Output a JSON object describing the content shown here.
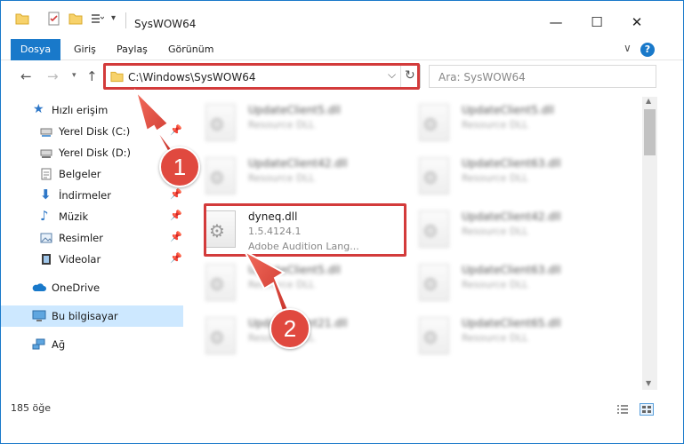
{
  "window": {
    "title": "SysWOW64",
    "minimize_glyph": "—",
    "maximize_glyph": "☐",
    "close_glyph": "✕"
  },
  "ribbon": {
    "tabs": [
      "Dosya",
      "Giriş",
      "Paylaş",
      "Görünüm"
    ],
    "expand_glyph": "∨",
    "help_glyph": "?"
  },
  "address": {
    "path": "C:\\Windows\\SysWOW64",
    "search_placeholder": "Ara: SysWOW64"
  },
  "nav": {
    "items": [
      {
        "label": "Hızlı erişim",
        "icon": "star-icon",
        "pinned": false
      },
      {
        "label": "Yerel Disk (C:)",
        "icon": "drive-icon",
        "pinned": true
      },
      {
        "label": "Yerel Disk (D:)",
        "icon": "drive-icon",
        "pinned": false
      },
      {
        "label": "Belgeler",
        "icon": "documents-icon",
        "pinned": true
      },
      {
        "label": "İndirmeler",
        "icon": "download-icon",
        "pinned": true
      },
      {
        "label": "Müzik",
        "icon": "music-icon",
        "pinned": true
      },
      {
        "label": "Resimler",
        "icon": "pictures-icon",
        "pinned": true
      },
      {
        "label": "Videolar",
        "icon": "video-icon",
        "pinned": true
      },
      {
        "label": "OneDrive",
        "icon": "cloud-icon",
        "pinned": false
      },
      {
        "label": "Bu bilgisayar",
        "icon": "computer-icon",
        "pinned": false
      },
      {
        "label": "Ağ",
        "icon": "network-icon",
        "pinned": false
      }
    ]
  },
  "files": {
    "left": [
      {
        "name": "UpdateClient5.dll",
        "sub1": "Resource DLL",
        "sub2": ""
      },
      {
        "name": "UpdateClient42.dll",
        "sub1": "Resource DLL",
        "sub2": ""
      },
      {
        "name": "dyneq.dll",
        "sub1": "1.5.4124.1",
        "sub2": "Adobe Audition Lang..."
      },
      {
        "name": "UpdateClient5.dll",
        "sub1": "Resource DLL",
        "sub2": ""
      },
      {
        "name": "UpdateClient21.dll",
        "sub1": "Resource DLL",
        "sub2": ""
      }
    ],
    "right": [
      {
        "name": "UpdateClient5.dll",
        "sub1": "Resource DLL"
      },
      {
        "name": "UpdateClient63.dll",
        "sub1": "Resource DLL"
      },
      {
        "name": "UpdateClient42.dll",
        "sub1": "Resource DLL"
      },
      {
        "name": "UpdateClient63.dll",
        "sub1": "Resource DLL"
      },
      {
        "name": "UpdateClient65.dll",
        "sub1": "Resource DLL"
      }
    ]
  },
  "status": {
    "count_text": "185 öğe"
  },
  "annotations": {
    "badge1": "1",
    "badge2": "2",
    "color": "#d33b3b"
  }
}
